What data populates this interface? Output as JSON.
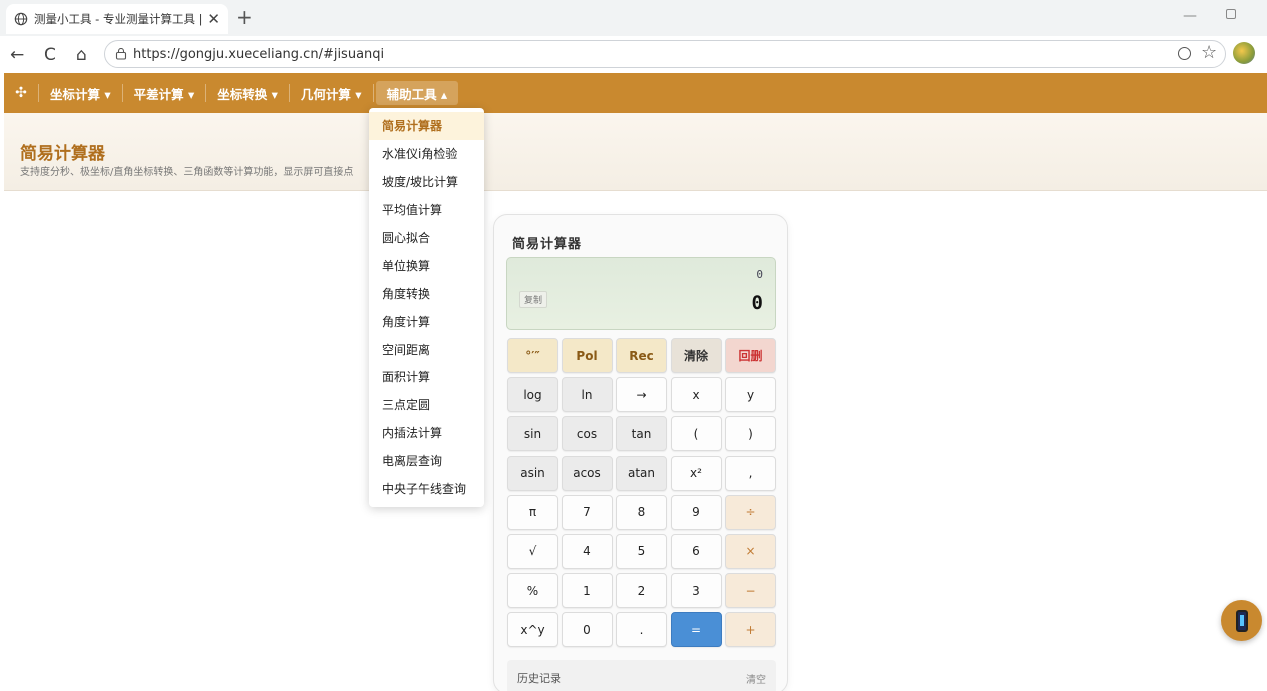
{
  "browser": {
    "tab_title": "测量小工具 - 专业测量计算工具 | 免",
    "tab_close": "✕",
    "new_tab": "+",
    "back": "←",
    "reload": "C",
    "home": "⌂",
    "url_host": "https://gongju.xueceliang.cn",
    "url_path": "/#jisuanqi",
    "star": "☆",
    "minimize": "—"
  },
  "nav": {
    "brand_icon": "✣",
    "items": [
      {
        "label": "坐标计算 ▾"
      },
      {
        "label": "平差计算 ▾"
      },
      {
        "label": "坐标转换 ▾"
      },
      {
        "label": "几何计算 ▾"
      },
      {
        "label": "辅助工具 ▴"
      }
    ]
  },
  "header": {
    "title": "简易计算器",
    "subtitle": "支持度分秒、极坐标/直角坐标转换、三角函数等计算功能，显示屏可直接点"
  },
  "dropdown": {
    "items": [
      {
        "label": "简易计算器",
        "selected": true
      },
      {
        "label": "水准仪i角检验"
      },
      {
        "label": "坡度/坡比计算"
      },
      {
        "label": "平均值计算"
      },
      {
        "label": "圆心拟合"
      },
      {
        "label": "单位换算"
      },
      {
        "label": "角度转换"
      },
      {
        "label": "角度计算"
      },
      {
        "label": "空间距离"
      },
      {
        "label": "面积计算"
      },
      {
        "label": "三点定圆"
      },
      {
        "label": "内插法计算"
      },
      {
        "label": "电离层查询"
      },
      {
        "label": "中央子午线查询"
      }
    ]
  },
  "calculator": {
    "title": "简易计算器",
    "expression": "0",
    "result": "0",
    "copy_label": "复制",
    "keys": [
      {
        "label": "°′″",
        "style": "gold"
      },
      {
        "label": "Pol",
        "style": "gold"
      },
      {
        "label": "Rec",
        "style": "gold"
      },
      {
        "label": "清除",
        "style": "clear"
      },
      {
        "label": "回删",
        "style": "back"
      },
      {
        "label": "log",
        "style": "fn"
      },
      {
        "label": "ln",
        "style": "fn"
      },
      {
        "label": "→",
        "style": "num"
      },
      {
        "label": "x",
        "style": "num"
      },
      {
        "label": "y",
        "style": "num"
      },
      {
        "label": "sin",
        "style": "fn"
      },
      {
        "label": "cos",
        "style": "fn"
      },
      {
        "label": "tan",
        "style": "fn"
      },
      {
        "label": "(",
        "style": "num"
      },
      {
        "label": ")",
        "style": "num"
      },
      {
        "label": "asin",
        "style": "fn"
      },
      {
        "label": "acos",
        "style": "fn"
      },
      {
        "label": "atan",
        "style": "fn"
      },
      {
        "label": "x²",
        "style": "num"
      },
      {
        "label": ",",
        "style": "num"
      },
      {
        "label": "π",
        "style": "num"
      },
      {
        "label": "7",
        "style": "num"
      },
      {
        "label": "8",
        "style": "num"
      },
      {
        "label": "9",
        "style": "num"
      },
      {
        "label": "÷",
        "style": "op"
      },
      {
        "label": "√",
        "style": "num"
      },
      {
        "label": "4",
        "style": "num"
      },
      {
        "label": "5",
        "style": "num"
      },
      {
        "label": "6",
        "style": "num"
      },
      {
        "label": "×",
        "style": "op"
      },
      {
        "label": "%",
        "style": "num"
      },
      {
        "label": "1",
        "style": "num"
      },
      {
        "label": "2",
        "style": "num"
      },
      {
        "label": "3",
        "style": "num"
      },
      {
        "label": "−",
        "style": "op"
      },
      {
        "label": "x^y",
        "style": "num"
      },
      {
        "label": "0",
        "style": "num"
      },
      {
        "label": ".",
        "style": "num"
      },
      {
        "label": "=",
        "style": "eq"
      },
      {
        "label": "+",
        "style": "op"
      }
    ],
    "history_label": "历史记录",
    "history_clear": "清空"
  },
  "colors": {
    "brand": "#c9892f",
    "accent_text": "#b06f1e",
    "equals": "#4a8fd6"
  },
  "icons": {
    "tab": "globe-icon",
    "address": "site-info-icon",
    "zoom": "zoom-out-icon",
    "fab": "mobile-phone-icon"
  }
}
